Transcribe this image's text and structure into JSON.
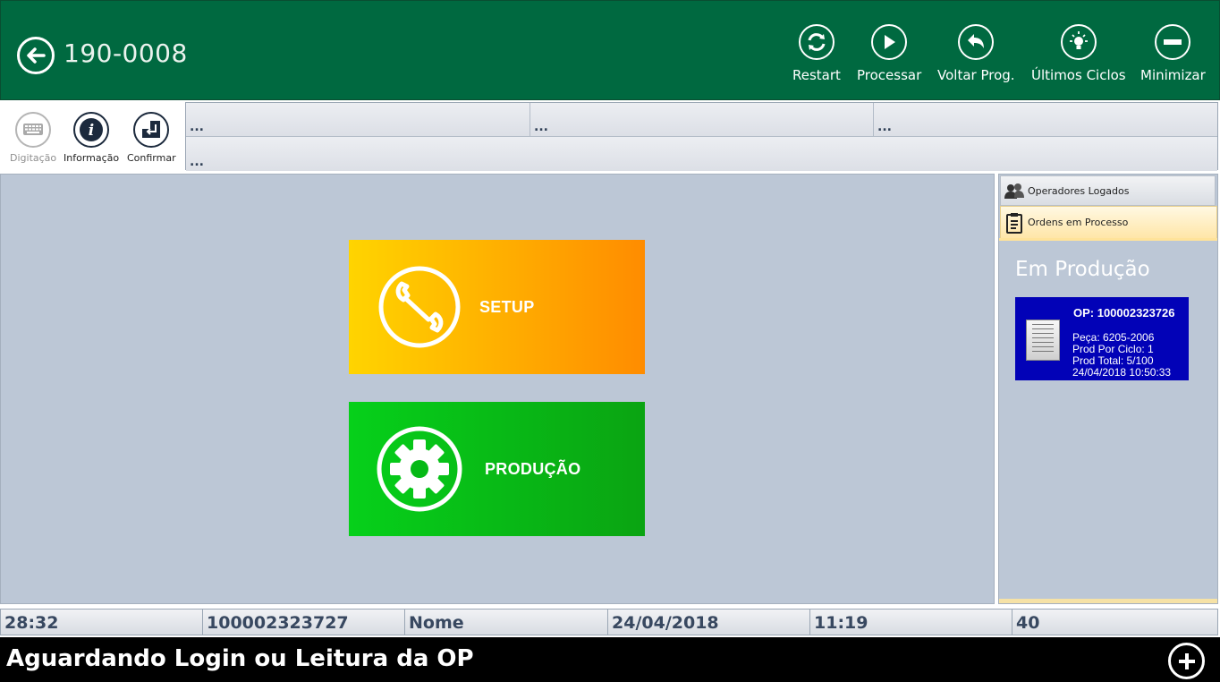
{
  "header": {
    "title": "190-0008",
    "tools": [
      {
        "label": "Restart",
        "icon": "restart-icon"
      },
      {
        "label": "Processar",
        "icon": "play-icon"
      },
      {
        "label": "Voltar Prog.",
        "icon": "undo-icon"
      },
      {
        "label": "Últimos Ciclos",
        "icon": "lightbulb-icon"
      },
      {
        "label": "Minimizar",
        "icon": "minus-icon"
      }
    ]
  },
  "subtoolbar": {
    "digitacao": "Digitação",
    "informacao": "Informação",
    "confirmar": "Confirmar"
  },
  "info_cells": [
    "...",
    "...",
    "...",
    "..."
  ],
  "main": {
    "setup_label": "SETUP",
    "producao_label": "PRODUÇÃO"
  },
  "side": {
    "tabs": [
      "Operadores Logados",
      "Ordens em Processo"
    ],
    "title": "Em Produção",
    "card": {
      "op": "OP: 100002323726",
      "peca": "Peça: 6205-2006",
      "prod_por_ciclo": "Prod Por Ciclo: 1",
      "prod_total": "Prod Total: 5/100",
      "datetime": "24/04/2018 10:50:33"
    }
  },
  "status": [
    "28:32",
    "100002323727",
    "Nome",
    "24/04/2018",
    "11:19",
    "40"
  ],
  "message": "Aguardando Login ou Leitura da OP",
  "colors": {
    "header": "#006940",
    "setup_gradient": [
      "#ffd400",
      "#ff8c00"
    ],
    "producao_gradient": [
      "#06d01a",
      "#0aa412"
    ],
    "card": "#0202b7"
  }
}
